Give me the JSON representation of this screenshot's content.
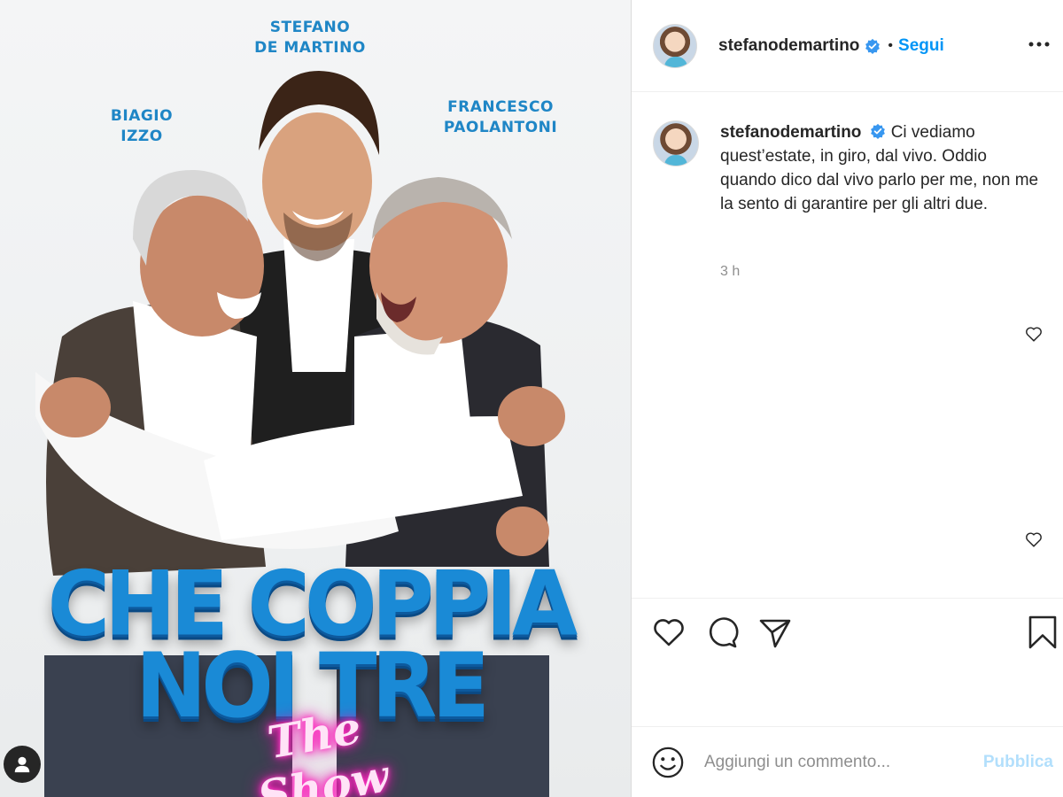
{
  "poster": {
    "cast": [
      {
        "name": "STEFANO\nDE MARTINO"
      },
      {
        "name": "BIAGIO\nIZZO"
      },
      {
        "name": "FRANCESCO\nPAOLANTONI"
      }
    ],
    "title": "CHE COPPIA NOI TRE",
    "subtitle": "The Show"
  },
  "post": {
    "header": {
      "username": "stefanodemartino",
      "separator": "•",
      "follow_label": "Segui"
    },
    "caption": {
      "username": "stefanodemartino",
      "text": "Ci vediamo quest’estate, in giro, dal vivo. Oddio quando dico dal vivo parlo per me, non me la sento di garantire per gli altri due.",
      "timestamp": "3 h"
    },
    "comment_bar": {
      "placeholder": "Aggiungi un commento...",
      "publish_label": "Pubblica"
    }
  },
  "icons": {
    "verified": "verified-badge-icon",
    "more": "more-options-icon",
    "like": "heart-icon",
    "comment": "comment-icon",
    "share": "paper-plane-icon",
    "save": "bookmark-icon",
    "emoji": "emoji-icon",
    "profile": "user-icon"
  },
  "colors": {
    "link_blue": "#0095f6",
    "verified_blue": "#3897f0",
    "publish_disabled": "#b2dffc",
    "timestamp_gray": "#8e8e8e",
    "poster_title_blue": "#1a8ad6",
    "poster_neon_pink": "#ff3fc8"
  }
}
